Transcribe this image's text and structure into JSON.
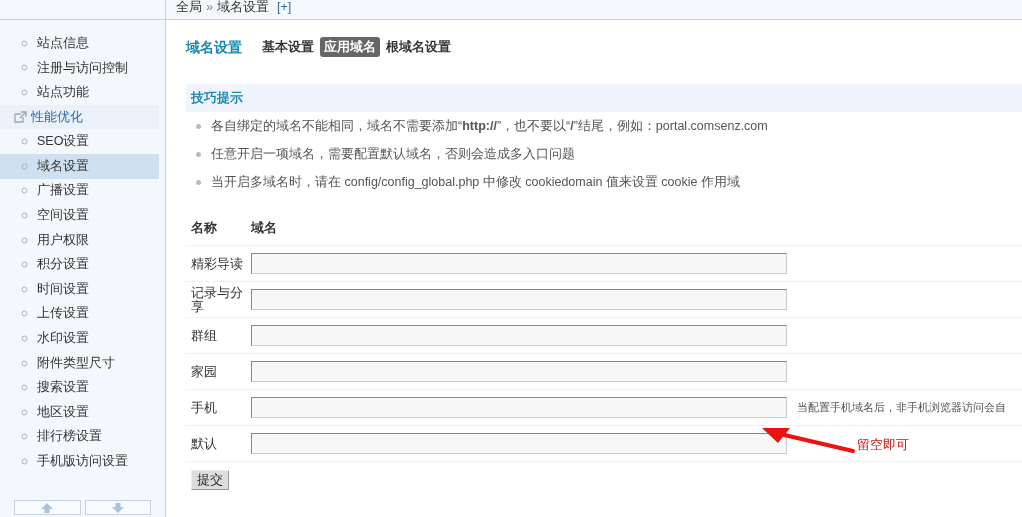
{
  "breadcrumb": {
    "root": "全局",
    "separator": "»",
    "current": "域名设置",
    "add": "[+]"
  },
  "sidebar": {
    "items": [
      {
        "label": "站点信息",
        "kind": "item",
        "selected": false
      },
      {
        "label": "注册与访问控制",
        "kind": "item",
        "selected": false
      },
      {
        "label": "站点功能",
        "kind": "item",
        "selected": false
      },
      {
        "label": "性能优化",
        "kind": "link",
        "selected": false
      },
      {
        "label": "SEO设置",
        "kind": "item",
        "selected": false
      },
      {
        "label": "域名设置",
        "kind": "item",
        "selected": true
      },
      {
        "label": "广播设置",
        "kind": "item",
        "selected": false
      },
      {
        "label": "空间设置",
        "kind": "item",
        "selected": false
      },
      {
        "label": "用户权限",
        "kind": "item",
        "selected": false
      },
      {
        "label": "积分设置",
        "kind": "item",
        "selected": false
      },
      {
        "label": "时间设置",
        "kind": "item",
        "selected": false
      },
      {
        "label": "上传设置",
        "kind": "item",
        "selected": false
      },
      {
        "label": "水印设置",
        "kind": "item",
        "selected": false
      },
      {
        "label": "附件类型尺寸",
        "kind": "item",
        "selected": false
      },
      {
        "label": "搜索设置",
        "kind": "item",
        "selected": false
      },
      {
        "label": "地区设置",
        "kind": "item",
        "selected": false
      },
      {
        "label": "排行榜设置",
        "kind": "item",
        "selected": false
      },
      {
        "label": "手机版访问设置",
        "kind": "item",
        "selected": false
      }
    ]
  },
  "page_title": "域名设置",
  "tabs": [
    {
      "label": "基本设置",
      "selected": false
    },
    {
      "label": "应用域名",
      "selected": true
    },
    {
      "label": "根域名设置",
      "selected": false
    }
  ],
  "tips": {
    "title": "技巧提示",
    "items": [
      "各自绑定的域名不能相同，域名不需要添加“**http://**”，也不要以“**/**”结尾，例如：portal.comsenz.com",
      "任意开启一项域名，需要配置默认域名，否则会造成多入口问题",
      "当开启多域名时，请在 config/config_global.php 中修改 cookiedomain 值来设置 cookie 作用域"
    ]
  },
  "table": {
    "columns": [
      "名称",
      "域名"
    ],
    "rows": [
      {
        "name": "精彩导读",
        "note": null
      },
      {
        "name": "记录与分享",
        "note": null
      },
      {
        "name": "群组",
        "note": null
      },
      {
        "name": "家园",
        "note": null
      },
      {
        "name": "手机",
        "note": "当配置手机域名后，非手机浏览器访问会自"
      },
      {
        "name": "默认",
        "note": null
      }
    ]
  },
  "submit": "提交",
  "annotation": {
    "text": "留空即可"
  }
}
